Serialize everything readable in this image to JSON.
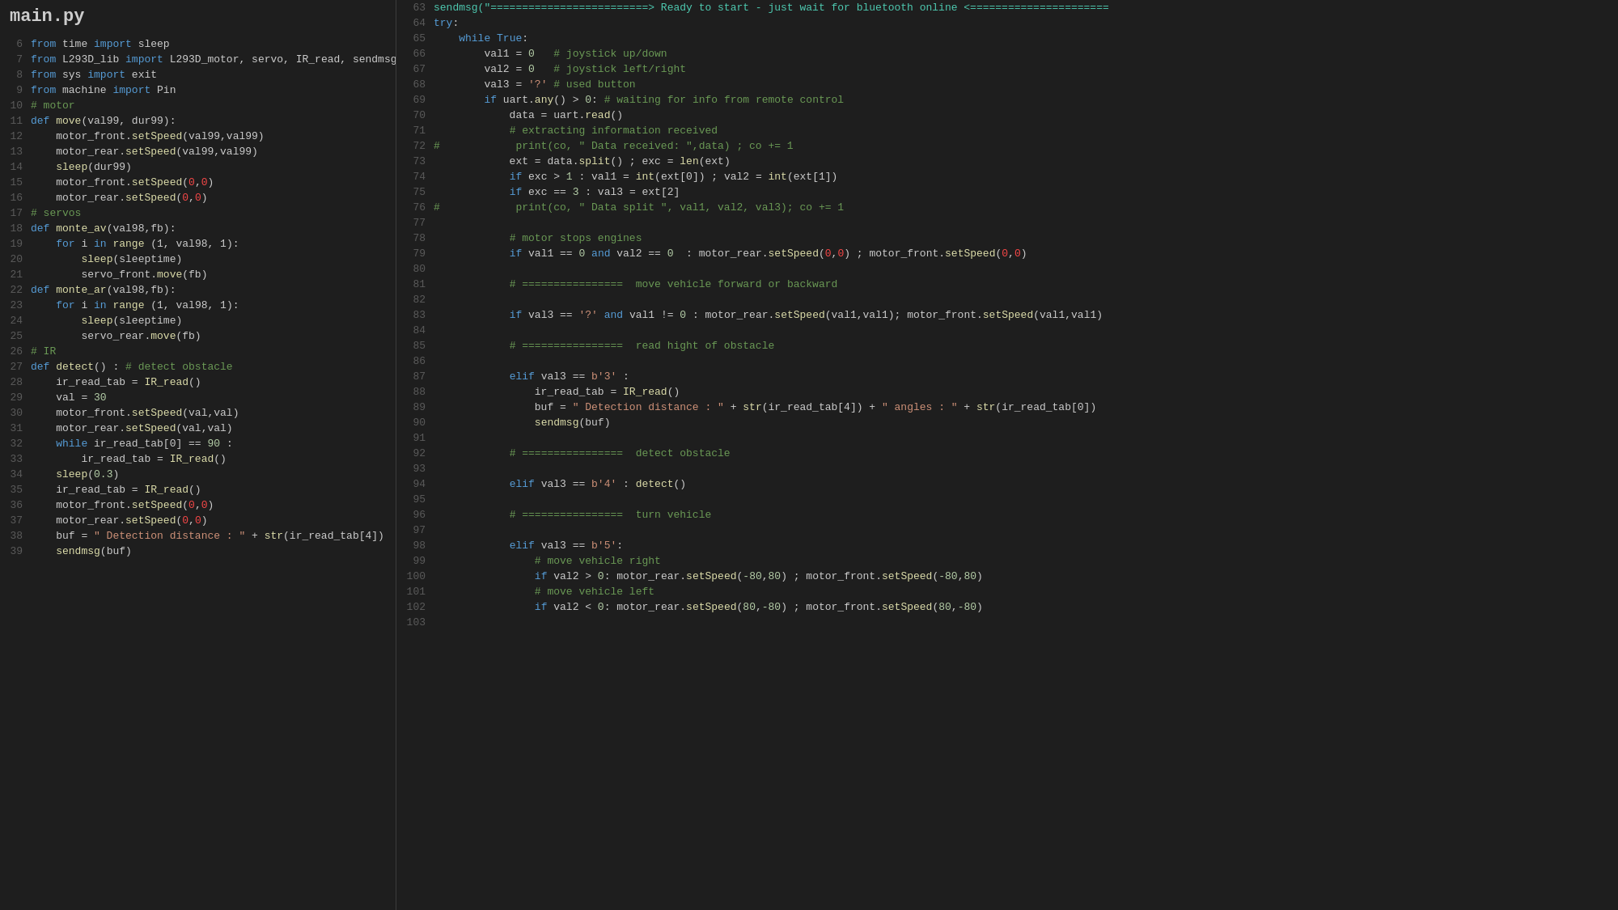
{
  "title": "main.py",
  "left_panel": {
    "lines": [
      {
        "num": "6",
        "content": "<span class='kw'>from</span> time <span class='kw'>import</span> sleep"
      },
      {
        "num": "7",
        "content": "<span class='kw'>from</span> L293D_lib <span class='kw'>import</span> L293D_motor, servo, IR_read, sendmsg"
      },
      {
        "num": "8",
        "content": "<span class='kw'>from</span> sys <span class='kw'>import</span> exit"
      },
      {
        "num": "9",
        "content": "<span class='kw'>from</span> machine <span class='kw'>import</span> Pin"
      },
      {
        "num": "10",
        "content": "<span class='comment'># motor</span>"
      },
      {
        "num": "11",
        "content": "<span class='kw'>def</span> <span class='fn'>move</span>(val99, dur99):"
      },
      {
        "num": "12",
        "content": "    motor_front.<span class='fn'>setSpeed</span>(val99,val99)"
      },
      {
        "num": "13",
        "content": "    motor_rear.<span class='fn'>setSpeed</span>(val99,val99)"
      },
      {
        "num": "14",
        "content": "    <span class='fn'>sleep</span>(dur99)"
      },
      {
        "num": "15",
        "content": "    motor_front.<span class='fn'>setSpeed</span>(<span class='red-num'>0</span>,<span class='red-num'>0</span>)"
      },
      {
        "num": "16",
        "content": "    motor_rear.<span class='fn'>setSpeed</span>(<span class='red-num'>0</span>,<span class='red-num'>0</span>)"
      },
      {
        "num": "17",
        "content": "<span class='comment'># servos</span>"
      },
      {
        "num": "18",
        "content": "<span class='kw'>def</span> <span class='fn'>monte_av</span>(val98,fb):"
      },
      {
        "num": "19",
        "content": "    <span class='kw'>for</span> i <span class='kw'>in</span> <span class='fn'>range</span> (1, val98, 1):"
      },
      {
        "num": "20",
        "content": "        <span class='fn'>sleep</span>(sleeptime)"
      },
      {
        "num": "21",
        "content": "        servo_front.<span class='fn'>move</span>(fb)"
      },
      {
        "num": "22",
        "content": "<span class='kw'>def</span> <span class='fn'>monte_ar</span>(val98,fb):"
      },
      {
        "num": "23",
        "content": "    <span class='kw'>for</span> i <span class='kw'>in</span> <span class='fn'>range</span> (1, val98, 1):"
      },
      {
        "num": "24",
        "content": "        <span class='fn'>sleep</span>(sleeptime)"
      },
      {
        "num": "25",
        "content": "        servo_rear.<span class='fn'>move</span>(fb)"
      },
      {
        "num": "26",
        "content": "<span class='comment'># IR</span>"
      },
      {
        "num": "27",
        "content": "<span class='kw'>def</span> <span class='fn'>detect</span>() : <span class='comment'># detect obstacle</span>"
      },
      {
        "num": "28",
        "content": "    ir_read_tab = <span class='fn'>IR_read</span>()"
      },
      {
        "num": "29",
        "content": "    val = <span class='num'>30</span>"
      },
      {
        "num": "30",
        "content": "    motor_front.<span class='fn'>setSpeed</span>(val,val)"
      },
      {
        "num": "31",
        "content": "    motor_rear.<span class='fn'>setSpeed</span>(val,val)"
      },
      {
        "num": "32",
        "content": "    <span class='kw'>while</span> ir_read_tab[0] == <span class='num'>90</span> :"
      },
      {
        "num": "33",
        "content": "        ir_read_tab = <span class='fn'>IR_read</span>()"
      },
      {
        "num": "34",
        "content": "    <span class='fn'>sleep</span>(<span class='num'>0.3</span>)"
      },
      {
        "num": "35",
        "content": "    ir_read_tab = <span class='fn'>IR_read</span>()"
      },
      {
        "num": "36",
        "content": "    motor_front.<span class='fn'>setSpeed</span>(<span class='red-num'>0</span>,<span class='red-num'>0</span>)"
      },
      {
        "num": "37",
        "content": "    motor_rear.<span class='fn'>setSpeed</span>(<span class='red-num'>0</span>,<span class='red-num'>0</span>)"
      },
      {
        "num": "38",
        "content": "    buf = <span class='str'>\" Detection distance : \"</span> + <span class='fn'>str</span>(ir_read_tab[4])"
      },
      {
        "num": "39",
        "content": "    <span class='fn'>sendmsg</span>(buf)"
      }
    ]
  },
  "right_panel": {
    "top_line": "sendmsg(\"=========================> Ready to start - just wait for bluetooth online <======================",
    "lines": [
      {
        "num": "64",
        "content": "<span class='kw'>try</span>:"
      },
      {
        "num": "65",
        "content": "    <span class='kw'>while</span> <span class='kw'>True</span>:"
      },
      {
        "num": "66",
        "content": "        val1 = <span class='num'>0</span>   <span class='comment'># joystick up/down</span>"
      },
      {
        "num": "67",
        "content": "        val2 = <span class='num'>0</span>   <span class='comment'># joystick left/right</span>"
      },
      {
        "num": "68",
        "content": "        val3 = <span class='str'>'?'</span> <span class='comment'># used button</span>"
      },
      {
        "num": "69",
        "content": "        <span class='kw'>if</span> uart.<span class='fn'>any</span>() > <span class='num'>0</span>: <span class='comment'># waiting for info from remote control</span>"
      },
      {
        "num": "70",
        "content": "            data = uart.<span class='fn'>read</span>()"
      },
      {
        "num": "71",
        "content": "            <span class='comment'># extracting information received</span>"
      },
      {
        "num": "72",
        "content": "<span class='comment'>#            print(co, \" Data received: \",data) ; co += 1</span>"
      },
      {
        "num": "73",
        "content": "            ext = data.<span class='fn'>split</span>() ; exc = <span class='fn'>len</span>(ext)"
      },
      {
        "num": "74",
        "content": "            <span class='kw'>if</span> exc > <span class='num'>1</span> : val1 = <span class='fn'>int</span>(ext[0]) ; val2 = <span class='fn'>int</span>(ext[1])"
      },
      {
        "num": "75",
        "content": "            <span class='kw'>if</span> exc == <span class='num'>3</span> : val3 = ext[2]"
      },
      {
        "num": "76",
        "content": "<span class='comment'>#            print(co, \" Data split \", val1, val2, val3); co += 1</span>"
      },
      {
        "num": "77",
        "content": ""
      },
      {
        "num": "78",
        "content": "            <span class='comment'># motor stops engines</span>"
      },
      {
        "num": "79",
        "content": "            <span class='kw'>if</span> val1 == <span class='num'>0</span> <span class='kw'>and</span> val2 == <span class='num'>0</span>  : motor_rear.<span class='fn'>setSpeed</span>(<span class='red-num'>0</span>,<span class='red-num'>0</span>) ; motor_front.<span class='fn'>setSpeed</span>(<span class='red-num'>0</span>,<span class='red-num'>0</span>)"
      },
      {
        "num": "80",
        "content": ""
      },
      {
        "num": "81",
        "content": "            <span class='comment'># ================  move vehicle forward or backward</span>"
      },
      {
        "num": "82",
        "content": ""
      },
      {
        "num": "83",
        "content": "            <span class='kw'>if</span> val3 == <span class='str'>'?'</span> <span class='kw'>and</span> val1 != <span class='num'>0</span> : motor_rear.<span class='fn'>setSpeed</span>(val1,val1); motor_front.<span class='fn'>setSpeed</span>(val1,val1)"
      },
      {
        "num": "84",
        "content": ""
      },
      {
        "num": "85",
        "content": "            <span class='comment'># ================  read hight of obstacle</span>"
      },
      {
        "num": "86",
        "content": ""
      },
      {
        "num": "87",
        "content": "            <span class='kw'>elif</span> val3 == <span class='str'>b'3'</span> :"
      },
      {
        "num": "88",
        "content": "                ir_read_tab = <span class='fn'>IR_read</span>()"
      },
      {
        "num": "89",
        "content": "                buf = <span class='str'>\" Detection distance : \"</span> + <span class='fn'>str</span>(ir_read_tab[4]) + <span class='str'>\" angles : \"</span> + <span class='fn'>str</span>(ir_read_tab[0])"
      },
      {
        "num": "90",
        "content": "                <span class='fn'>sendmsg</span>(buf)"
      },
      {
        "num": "91",
        "content": ""
      },
      {
        "num": "92",
        "content": "            <span class='comment'># ================  detect obstacle</span>"
      },
      {
        "num": "93",
        "content": ""
      },
      {
        "num": "94",
        "content": "            <span class='kw'>elif</span> val3 == <span class='str'>b'4'</span> : <span class='fn'>detect</span>()"
      },
      {
        "num": "95",
        "content": ""
      },
      {
        "num": "96",
        "content": "            <span class='comment'># ================  turn vehicle</span>"
      },
      {
        "num": "97",
        "content": ""
      },
      {
        "num": "98",
        "content": "            <span class='kw'>elif</span> val3 == <span class='str'>b'5'</span>:"
      },
      {
        "num": "99",
        "content": "                <span class='comment'># move vehicle right</span>"
      },
      {
        "num": "100",
        "content": "                <span class='kw'>if</span> val2 > <span class='num'>0</span>: motor_rear.<span class='fn'>setSpeed</span>(<span class='num'>-80</span>,<span class='num'>80</span>) ; motor_front.<span class='fn'>setSpeed</span>(<span class='num'>-80</span>,<span class='num'>80</span>)"
      },
      {
        "num": "101",
        "content": "                <span class='comment'># move vehicle left</span>"
      },
      {
        "num": "102",
        "content": "                <span class='kw'>if</span> val2 < <span class='num'>0</span>: motor_rear.<span class='fn'>setSpeed</span>(<span class='num'>80</span>,<span class='num'>-80</span>) ; motor_front.<span class='fn'>setSpeed</span>(<span class='num'>80</span>,<span class='num'>-80</span>)"
      },
      {
        "num": "103",
        "content": ""
      }
    ]
  }
}
